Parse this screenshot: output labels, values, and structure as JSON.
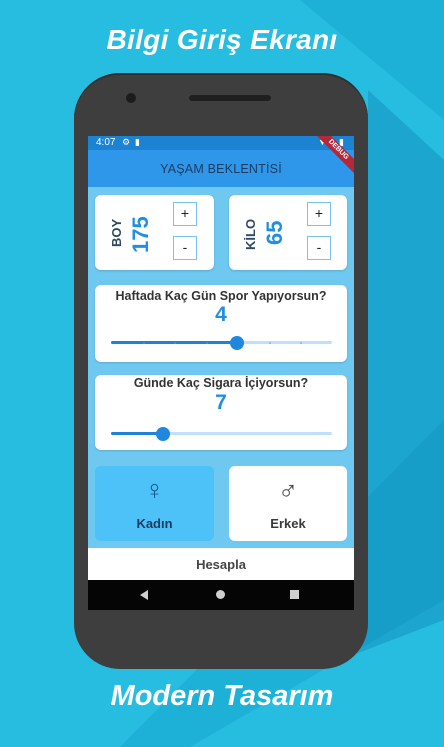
{
  "promo": {
    "top_text": "Bilgi Giriş Ekranı",
    "bottom_text": "Modern Tasarım"
  },
  "status_bar": {
    "time": "4:07",
    "debug_banner": "DEBUG"
  },
  "app_bar": {
    "title": "YAŞAM BEKLENTİSİ"
  },
  "height_card": {
    "label": "BOY",
    "value": "175",
    "plus": "+",
    "minus": "-"
  },
  "weight_card": {
    "label": "KİLO",
    "value": "65",
    "plus": "+",
    "minus": "-"
  },
  "sport_card": {
    "question": "Haftada Kaç Gün Spor Yapıyorsun?",
    "value": "4",
    "slider": {
      "value": 4,
      "min": 0,
      "max": 7
    }
  },
  "smoke_card": {
    "question": "Günde Kaç Sigara İçiyorsun?",
    "value": "7",
    "slider": {
      "value": 7,
      "min": 0,
      "max": 30
    }
  },
  "gender": {
    "female": {
      "label": "Kadın",
      "icon": "female-symbol-icon",
      "selected": true
    },
    "male": {
      "label": "Erkek",
      "icon": "male-symbol-icon",
      "selected": false
    }
  },
  "calculate_button": {
    "label": "Hesapla"
  },
  "colors": {
    "background": "#27bde0",
    "accent": "#1f8fe4",
    "app_bar": "#2f97ea",
    "selected_card": "#4cc2f8"
  }
}
